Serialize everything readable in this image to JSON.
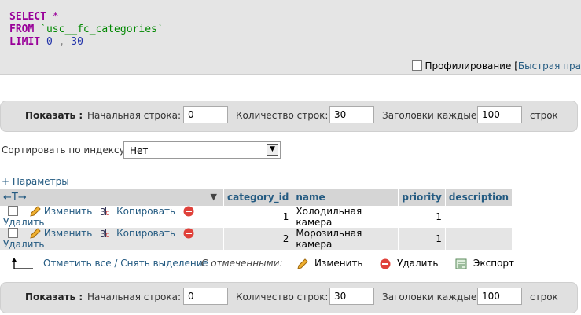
{
  "sql": {
    "select_kw": "SELECT",
    "star": "*",
    "from_kw": "FROM",
    "table": "`usc__fc_categories`",
    "limit_kw": "LIMIT",
    "offset": "0",
    "comma": ",",
    "count": "30"
  },
  "profiling": {
    "label": "Профилирование",
    "bracket": "[",
    "quick_edit": "Быстрая пра"
  },
  "nav": {
    "show_label": "Показать :",
    "start_label": "Начальная строка:",
    "start_value": "0",
    "rows_label": "Количество строк:",
    "rows_value": "30",
    "headers_label": "Заголовки каждые",
    "headers_value": "100",
    "rows_unit": "строк"
  },
  "sort": {
    "label": "Сортировать по индексу:",
    "value": "Нет"
  },
  "params_link": "+ Параметры",
  "table": {
    "arrows": "←T→",
    "columns": [
      "category_id",
      "name",
      "priority",
      "description"
    ],
    "actions": {
      "edit": "Изменить",
      "copy": "Копировать",
      "delete": "Удалить"
    },
    "rows": [
      {
        "category_id": "1",
        "name": "Холодильная камера",
        "priority": "1",
        "description": ""
      },
      {
        "category_id": "2",
        "name": "Морозильная камера",
        "priority": "1",
        "description": ""
      }
    ]
  },
  "bulk": {
    "select_all": "Отметить все / Снять выделение",
    "with_selected": "С отмеченными:",
    "edit": "Изменить",
    "delete": "Удалить",
    "export": "Экспорт"
  },
  "colors": {
    "link": "#235a81",
    "keyword": "#990099",
    "bar": "#e0e0e0"
  }
}
